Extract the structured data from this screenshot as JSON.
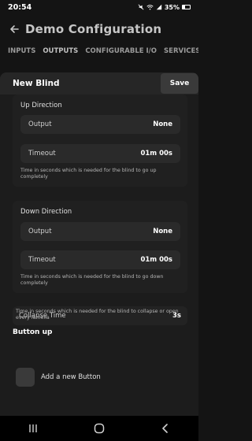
{
  "status_bar": {
    "time": "20:54",
    "battery": "35%"
  },
  "app_bar": {
    "title": "Demo Configuration"
  },
  "tabs": [
    {
      "label": "INPUTS",
      "active": false
    },
    {
      "label": "OUTPUTS",
      "active": true
    },
    {
      "label": "CONFIGURABLE I/O",
      "active": false
    },
    {
      "label": "SERVICES",
      "active": false
    }
  ],
  "dialog": {
    "title": "New Blind",
    "save_label": "Save",
    "up_direction": {
      "title": "Up Direction",
      "output_label": "Output",
      "output_value": "None",
      "timeout_label": "Timeout",
      "timeout_value": "01m 00s",
      "help": "Time in seconds which is needed for the blind to go up completely"
    },
    "down_direction": {
      "title": "Down Direction",
      "output_label": "Output",
      "output_value": "None",
      "timeout_label": "Timeout",
      "timeout_value": "01m 00s",
      "help": "Time in seconds which is needed for the blind to go down completely"
    },
    "collapse": {
      "label": "Collapse Time",
      "value": "3s",
      "help": "Time in seconds which is needed for the blind to collapse or open every lamella"
    },
    "button_up": {
      "heading": "Button up",
      "add_label": "Add a new Button"
    }
  }
}
